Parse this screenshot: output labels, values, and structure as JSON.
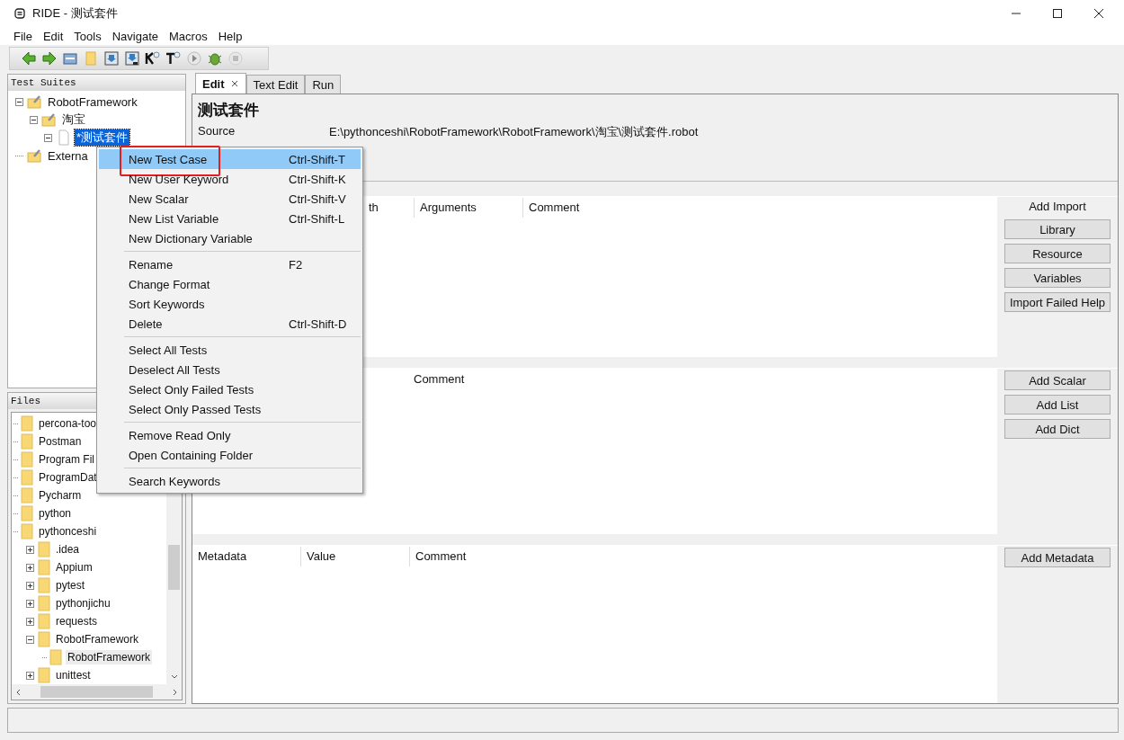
{
  "window": {
    "title": "RIDE - 测试套件"
  },
  "menu": [
    "File",
    "Edit",
    "Tools",
    "Navigate",
    "Macros",
    "Help"
  ],
  "suites": {
    "title": "Test Suites",
    "tree": [
      {
        "label": "RobotFramework",
        "kind": "suite",
        "expanded": true,
        "selected": false,
        "children": [
          {
            "label": "淘宝",
            "kind": "suite",
            "expanded": true,
            "selected": false,
            "children": [
              {
                "label": "*测试套件",
                "kind": "file",
                "expanded": true,
                "selected": true
              }
            ]
          }
        ]
      },
      {
        "label": "Externa",
        "kind": "suite",
        "selected": false
      }
    ]
  },
  "files": {
    "title": "Files",
    "tree": [
      {
        "label": "percona-too",
        "selected": false
      },
      {
        "label": "Postman",
        "selected": false
      },
      {
        "label": "Program Fil",
        "selected": false
      },
      {
        "label": "ProgramDat",
        "selected": false
      },
      {
        "label": "Pycharm",
        "selected": false
      },
      {
        "label": "python",
        "selected": false
      },
      {
        "label": "pythonceshi",
        "selected": false,
        "children": [
          {
            "label": ".idea",
            "expanded": false,
            "selected": false
          },
          {
            "label": "Appium",
            "expanded": false,
            "selected": false
          },
          {
            "label": "pytest",
            "expanded": false,
            "selected": false
          },
          {
            "label": "pythonjichu",
            "expanded": false,
            "selected": false
          },
          {
            "label": "requests",
            "expanded": false,
            "selected": false
          },
          {
            "label": "RobotFramework",
            "expanded": true,
            "selected": false,
            "children": [
              {
                "label": "RobotFramework",
                "selected": true
              }
            ]
          },
          {
            "label": "unittest",
            "expanded": false,
            "selected": false
          }
        ]
      }
    ]
  },
  "tabs": [
    {
      "label": "Edit",
      "selected": true,
      "closable": true
    },
    {
      "label": "Text Edit",
      "selected": false
    },
    {
      "label": "Run",
      "selected": false
    }
  ],
  "editor": {
    "suite_title": "测试套件",
    "source_label": "Source",
    "source_value": "E:\\pythonceshi\\RobotFramework\\RobotFramework\\淘宝\\测试套件.robot",
    "imports": {
      "columns": [
        "th",
        "Arguments",
        "Comment"
      ],
      "heading": "Add Import",
      "buttons": [
        "Library",
        "Resource",
        "Variables",
        "Import Failed Help"
      ]
    },
    "variables": {
      "columns": [
        "Comment"
      ],
      "buttons": [
        "Add Scalar",
        "Add List",
        "Add Dict"
      ]
    },
    "metadata": {
      "columns": [
        "Metadata",
        "Value",
        "Comment"
      ],
      "buttons": [
        "Add Metadata"
      ]
    }
  },
  "context_menu": [
    [
      {
        "label": "New Test Case",
        "shortcut": "Ctrl-Shift-T",
        "selected": true,
        "marked": true
      },
      {
        "label": "New User Keyword",
        "shortcut": "Ctrl-Shift-K",
        "selected": false,
        "marked": false
      },
      {
        "label": "New Scalar",
        "shortcut": "Ctrl-Shift-V",
        "selected": false,
        "marked": false
      },
      {
        "label": "New List Variable",
        "shortcut": "Ctrl-Shift-L",
        "selected": false,
        "marked": false
      },
      {
        "label": "New Dictionary Variable",
        "selected": false,
        "marked": false
      }
    ],
    [
      {
        "label": "Rename",
        "shortcut": "F2",
        "selected": false,
        "marked": false
      },
      {
        "label": "Change Format",
        "selected": false,
        "marked": false
      },
      {
        "label": "Sort Keywords",
        "selected": false,
        "marked": false
      },
      {
        "label": "Delete",
        "shortcut": "Ctrl-Shift-D",
        "selected": false,
        "marked": false
      }
    ],
    [
      {
        "label": "Select All Tests",
        "selected": false,
        "marked": false
      },
      {
        "label": "Deselect All Tests",
        "selected": false,
        "marked": false
      },
      {
        "label": "Select Only Failed Tests",
        "selected": false,
        "marked": false
      },
      {
        "label": "Select Only Passed Tests",
        "selected": false,
        "marked": false
      }
    ],
    [
      {
        "label": "Remove Read Only",
        "selected": false,
        "marked": false
      },
      {
        "label": "Open Containing Folder",
        "selected": false,
        "marked": false
      }
    ],
    [
      {
        "label": "Search Keywords",
        "selected": false,
        "marked": false
      }
    ]
  ]
}
